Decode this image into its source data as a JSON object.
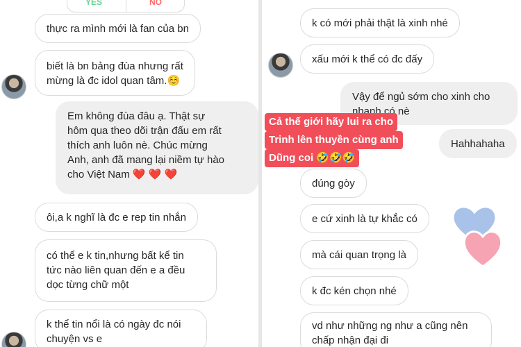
{
  "left_chat": {
    "poll": {
      "yes": "YES",
      "no": "NO"
    },
    "messages": [
      {
        "text": "thực ra mình mới là fan của bn"
      },
      {
        "text": "biết là bn bảng đùa nhưng rất\nmừng là đc idol quan tâm.☺️"
      },
      {
        "text": "Em không đùa đâu ạ. Thật sự\nhôm qua theo dõi trận đấu em rất\nthích anh luôn nè. Chúc mừng\nAnh, anh đã mang lại niềm tự hào\ncho Việt Nam ❤️ ❤️ ❤️"
      },
      {
        "text": "ôi,a k nghĩ là đc e rep tin nhắn"
      },
      {
        "text": "có thể e k tin,nhưng bất kể tin\ntức nào liên quan đến e a đều\ndọc từng chữ một"
      },
      {
        "text": "k thể tin nổi là có ngày đc nói\nchuyện vs e"
      }
    ]
  },
  "right_chat": {
    "messages": [
      {
        "text": "k có mới phải thật là xinh nhé"
      },
      {
        "text": "xấu mới k thể có đc đấy"
      },
      {
        "text": "Vậy để ngủ sớm cho xinh cho\nnhanh có nè"
      },
      {
        "text": "Hahhahaha"
      },
      {
        "text": "đúng gòy"
      },
      {
        "text": "e cứ xinh là tự khắc có"
      },
      {
        "text": "mà cái quan trọng là"
      },
      {
        "text": "k đc kén chọn nhé"
      },
      {
        "text": "vd như những ng như a cũng nên\nchấp nhận đại đi"
      }
    ],
    "overlay_caption": [
      "Cả thế giới hãy lui ra cho",
      "Trinh lên thuyền cùng anh",
      "Dũng coi 🤣🤣🤣"
    ]
  },
  "colors": {
    "overlay_bg": "#f24e5a",
    "heart_blue": "#a9c2ea",
    "heart_pink": "#f6a3b4"
  },
  "icons": [
    "avatar",
    "heart-sticker-blue",
    "heart-sticker-pink"
  ]
}
